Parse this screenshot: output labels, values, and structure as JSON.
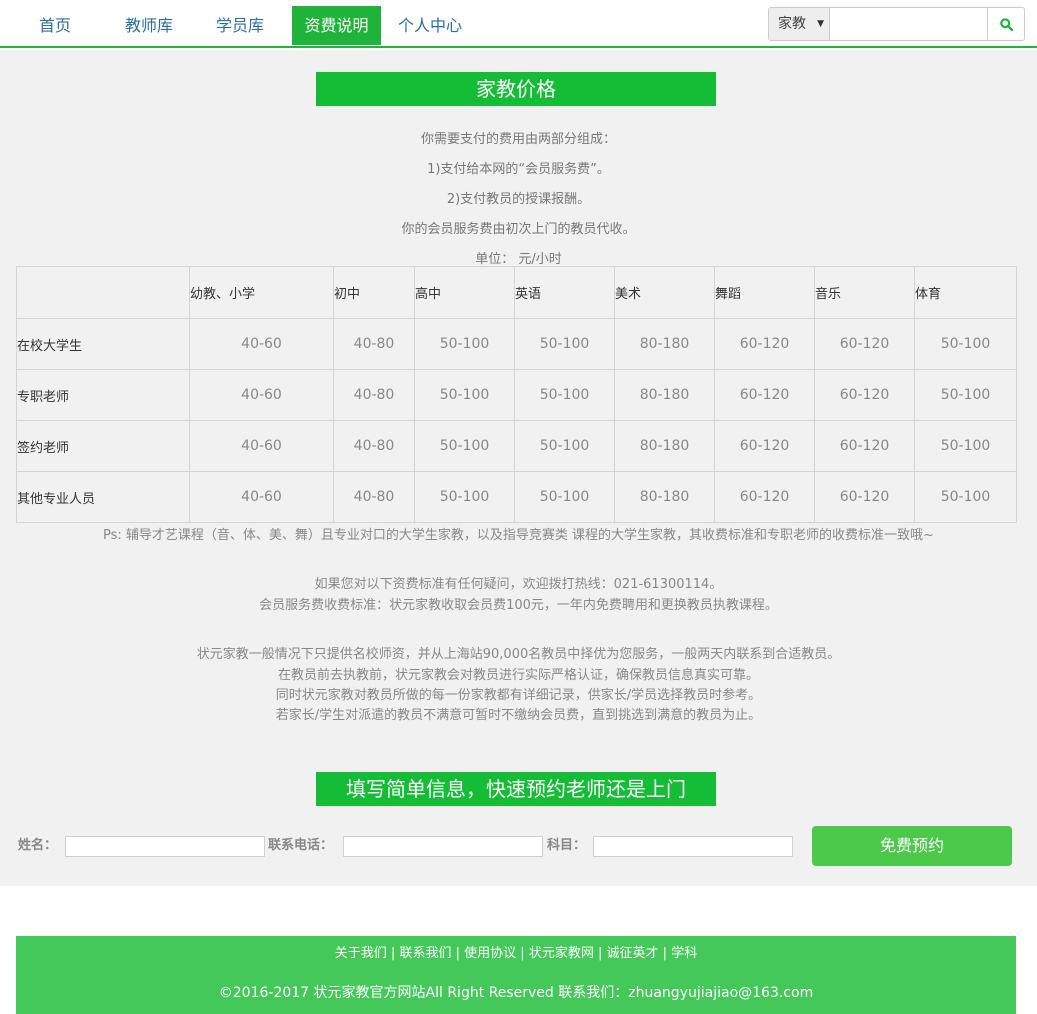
{
  "nav": {
    "items": [
      {
        "label": "首页"
      },
      {
        "label": "教师库"
      },
      {
        "label": "学员库"
      },
      {
        "label": "资费说明"
      },
      {
        "label": "个人中心"
      }
    ],
    "search": {
      "select_value": "家教",
      "input_value": "",
      "icon": "search-icon"
    },
    "accent_color": "#1fb33a"
  },
  "pricing": {
    "title": "家教价格",
    "intro": [
      "你需要支付的费用由两部分组成：",
      "1)支付给本网的“会员服务费”。",
      "2)支付教员的授课报酬。",
      "你的会员服务费由初次上门的教员代收。",
      "单位： 元/小时"
    ],
    "table": {
      "headers": [
        "",
        "幼教、小学",
        "初中",
        "高中",
        "英语",
        "美术",
        "舞蹈",
        "音乐",
        "体育"
      ],
      "rows": [
        {
          "label": "在校大学生",
          "values": [
            "40-60",
            "40-80",
            "50-100",
            "50-100",
            "80-180",
            "60-120",
            "60-120",
            "50-100"
          ]
        },
        {
          "label": "专职老师",
          "values": [
            "40-60",
            "40-80",
            "50-100",
            "50-100",
            "80-180",
            "60-120",
            "60-120",
            "50-100"
          ]
        },
        {
          "label": "签约老师",
          "values": [
            "40-60",
            "40-80",
            "50-100",
            "50-100",
            "80-180",
            "60-120",
            "60-120",
            "50-100"
          ]
        },
        {
          "label": "其他专业人员",
          "values": [
            "40-60",
            "40-80",
            "50-100",
            "50-100",
            "80-180",
            "60-120",
            "60-120",
            "50-100"
          ]
        }
      ]
    },
    "ps": "Ps: 辅导才艺课程（音、体、美、舞）且专业对口的大学生家教，以及指导竞赛类 课程的大学生家教，其收费标准和专职老师的收费标准一致哦~",
    "notes_contact": [
      "如果您对以下资费标准有任何疑问，欢迎拨打热线：021-61300114。",
      "会员服务费收费标准：状元家教收取会员费100元，一年内免费聘用和更换教员执教课程。"
    ],
    "notes_service": [
      "状元家教一般情况下只提供名校师资，并从上海站90,000名教员中择优为您服务，一般两天内联系到合适教员。",
      "在教员前去执教前，状元家教会对教员进行实际严格认证，确保教员信息真实可靠。",
      "同时状元家教对教员所做的每一份家教都有详细记录，供家长/学员选择教员时参考。",
      "若家长/学生对派遣的教员不满意可暂时不缴纳会员费，直到挑选到满意的教员为止。"
    ]
  },
  "booking": {
    "title": "填写简单信息，快速预约老师还是上门",
    "name_label": "姓名：",
    "name_value": "",
    "phone_label": "联系电话：",
    "phone_value": "",
    "subject_label": "科目：",
    "subject_value": "",
    "submit_label": "免费预约"
  },
  "footer": {
    "links": [
      "关于我们",
      "联系我们",
      "使用协议",
      "状元家教网",
      "诚征英才",
      "学科"
    ],
    "separator": "|",
    "copyright": "©2016-2017 状元家教官方网站All Right Reserved 联系我们：zhuangyujiajiao@163.com"
  }
}
